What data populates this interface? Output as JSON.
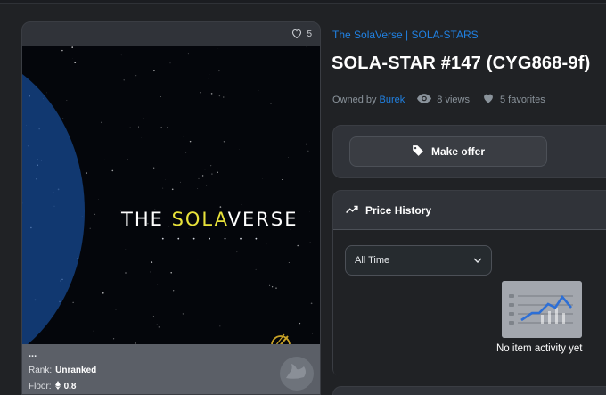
{
  "card": {
    "favorites_count": "5",
    "art_title_left": "THE ",
    "art_title_highlight": "SOLA",
    "art_title_right": "VERSE",
    "art_subtitle_dots": "• • • • • • •",
    "name_placeholder": "...",
    "rank_label": "Rank:",
    "rank_value": "Unranked",
    "floor_label": "Floor:",
    "floor_value": "0.8",
    "eth_icon": "ethereum-icon"
  },
  "item": {
    "collection_link": "The SolaVerse | SOLA-STARS",
    "title": "SOLA-STAR #147 (CYG868-9f)",
    "owned_by_label": "Owned by",
    "owner": "Burek",
    "views": "8 views",
    "favorites": "5 favorites"
  },
  "actions": {
    "make_offer": "Make offer"
  },
  "price_history": {
    "title": "Price History",
    "range_selected": "All Time",
    "empty_message": "No item activity yet"
  },
  "colors": {
    "accent": "#2081e2",
    "highlight_yellow": "#e8e23a",
    "background": "#202225",
    "panel": "#303339"
  }
}
